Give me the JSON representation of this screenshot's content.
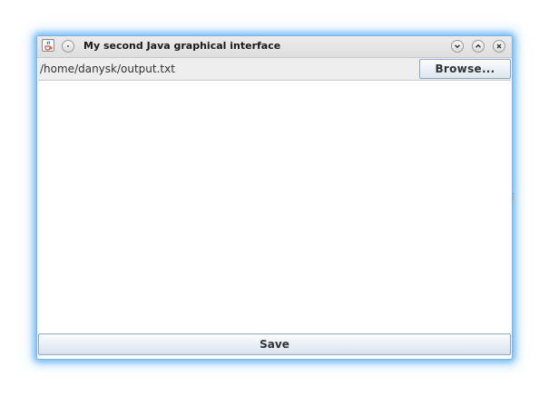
{
  "window": {
    "title": "My second Java graphical interface",
    "icons": {
      "app": "java-cup-icon",
      "menu": "window-menu-icon",
      "minimize": "chevron-down-icon",
      "maximize": "chevron-up-icon",
      "close": "close-icon"
    }
  },
  "file_row": {
    "path": "/home/danysk/output.txt",
    "browse_label": "Browse..."
  },
  "footer": {
    "save_label": "Save"
  },
  "colors": {
    "window_glow": "#50aaf0",
    "button_border": "#8ea7c4"
  }
}
